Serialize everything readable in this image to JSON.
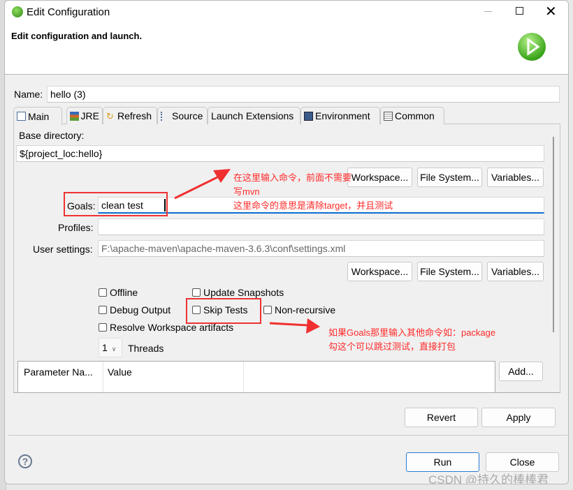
{
  "window": {
    "title": "Edit Configuration",
    "minimize_icon": "minimize-icon",
    "maximize_icon": "maximize-icon",
    "close_icon": "close-icon"
  },
  "header": {
    "description": "Edit configuration and launch.",
    "icon": "run-play-icon"
  },
  "name": {
    "label": "Name:",
    "value": "hello (3)"
  },
  "tabs": [
    {
      "label": "Main",
      "icon": "main-tab-icon",
      "active": true
    },
    {
      "label": "JRE",
      "icon": "jre-icon"
    },
    {
      "label": "Refresh",
      "icon": "refresh-icon"
    },
    {
      "label": "Source",
      "icon": "source-icon"
    },
    {
      "label": "Launch Extensions"
    },
    {
      "label": "Environment",
      "icon": "environment-icon"
    },
    {
      "label": "Common",
      "icon": "common-icon"
    }
  ],
  "main": {
    "base_directory_label": "Base directory:",
    "base_directory_value": "${project_loc:hello}",
    "buttons1": [
      "Workspace...",
      "File System...",
      "Variables..."
    ],
    "goals_label": "Goals:",
    "goals_value": "clean test",
    "profiles_label": "Profiles:",
    "profiles_value": "",
    "user_settings_label": "User settings:",
    "user_settings_value": "F:\\apache-maven\\apache-maven-3.6.3\\conf\\settings.xml",
    "buttons2": [
      "Workspace...",
      "File System...",
      "Variables..."
    ],
    "checkboxes": {
      "offline": "Offline",
      "update_snapshots": "Update Snapshots",
      "debug_output": "Debug Output",
      "skip_tests": "Skip Tests",
      "non_recursive": "Non-recursive",
      "resolve_workspace": "Resolve Workspace artifacts"
    },
    "threads_value": "1",
    "threads_label": "Threads",
    "table_headers": [
      "Parameter Na...",
      "Value"
    ],
    "add_button": "Add..."
  },
  "annotations": {
    "goals_line1": "在这里输入命令，前面不需要",
    "goals_line2": "写mvn",
    "goals_line3": "这里命令的意思是清除target，并且测试",
    "skip_line1": "如果Goals那里输入其他命令如：package",
    "skip_line2": "勾这个可以跳过测试，直接打包",
    "color": "#ff2a2a"
  },
  "footer": {
    "revert": "Revert",
    "apply": "Apply",
    "run": "Run",
    "close": "Close",
    "help_icon": "help-icon"
  },
  "watermark": "CSDN @持久的棒棒君"
}
